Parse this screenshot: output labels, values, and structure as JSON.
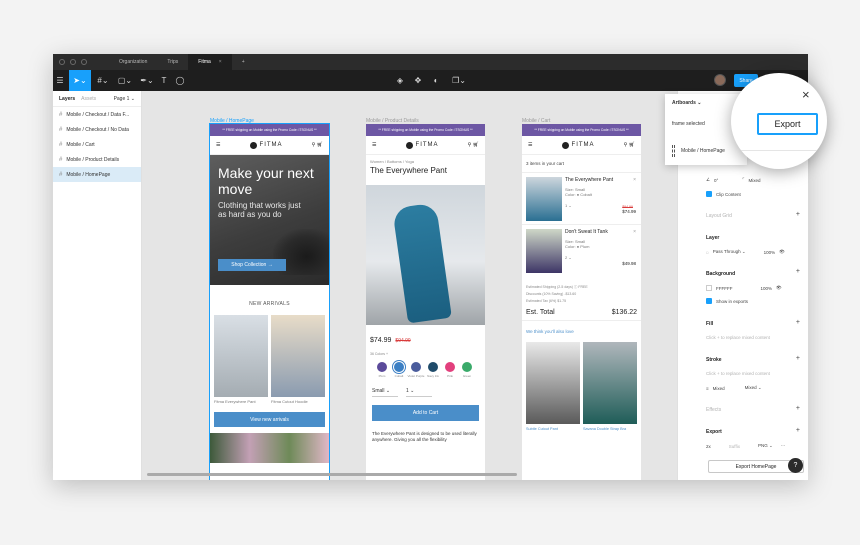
{
  "titlebar": {
    "tabs": [
      {
        "label": "Organization"
      },
      {
        "label": "Trips"
      },
      {
        "label": "Fitma",
        "active": true,
        "close": "×"
      },
      {
        "label": "+"
      }
    ]
  },
  "toolbar": {
    "share_label": "Share"
  },
  "layers": {
    "tab_layers": "Layers",
    "tab_assets": "Assets",
    "page": "Page 1 ⌄",
    "items": [
      {
        "label": "Mobile / Checkout / Data F..."
      },
      {
        "label": "Mobile / Checkout / No Data"
      },
      {
        "label": "Mobile / Cart"
      },
      {
        "label": "Mobile / Product Details"
      },
      {
        "label": "Mobile / HomePage",
        "selected": true
      }
    ]
  },
  "canvas": {
    "frame_labels": [
      "Mobile / HomePage",
      "Mobile / Product Details",
      "Mobile / Cart"
    ],
    "promo": "** FREE shipping on Mobile using the Promo Code: ITSONUS **",
    "logo": "FITMA",
    "home": {
      "headline": "Make your next move",
      "subhead": "Clothing that works just as hard as you do",
      "cta": "Shop Collection  →",
      "section": "NEW ARRIVALS",
      "captions": [
        "Fitma Everywhere Pant",
        "Fitma Cutout Hoodie"
      ],
      "view_btn": "View new arrivals"
    },
    "product": {
      "crumb": "Women / Bottoms / Yoga",
      "title": "The Everywhere Pant",
      "price": "$74.99",
      "old_price": "$94.99",
      "colors_label": "36 Colors +",
      "swatches": [
        {
          "name": "Plum",
          "color": "#5b4a9a"
        },
        {
          "name": "Cobalt",
          "color": "#3b7fc4"
        },
        {
          "name": "Violet Purple",
          "color": "#4a5c9c"
        },
        {
          "name": "Navy Ink",
          "color": "#1f4b6a"
        },
        {
          "name": "Pink",
          "color": "#e2407d"
        },
        {
          "name": "Green",
          "color": "#3aaa6a"
        }
      ],
      "size": "Small  ⌄",
      "qty": "1  ⌄",
      "add_cart": "Add to Cart",
      "desc": "The Everywhere Pant is designed to be used literally anywhere. Giving you all the flexibility"
    },
    "cart": {
      "count": "3 items in your cart",
      "items": [
        {
          "name": "The Everywhere Pant",
          "size": "Size:  Small",
          "color": "Color:  ● Cobalt",
          "qty": "1  ⌄",
          "old": "$94.99",
          "price": "$74.99"
        },
        {
          "name": "Don't Sweat It Tank",
          "size": "Size:  Small",
          "color": "Color:  ● Plum",
          "qty": "2  ⌄",
          "old": "",
          "price": "$49.98"
        }
      ],
      "summary": [
        "Estimated Shipping (2-5 days) ⓘ    FREE",
        "Discounts (10% Saving)    -$13.60",
        "Estimated Tax (6%)    $1.75"
      ],
      "total_label": "Est. Total",
      "total_value": "$136.22",
      "like": "We think you'll also love",
      "captions": [
        "Subtle Cutout Pant",
        "Savana Double Strap Bra"
      ]
    }
  },
  "props": {
    "clip": "Clip Content",
    "mixed": "Mixed",
    "angle": "0°",
    "layout_grid": "Layout Grid",
    "layer": "Layer",
    "pass": "Pass Through  ⌄",
    "pct": "100%",
    "background": "Background",
    "bg_hex": "FFFFFF",
    "bg_pct": "100%",
    "show_exports": "Show in exports",
    "fill": "Fill",
    "fill_hint": "Click + to replace mixed content",
    "stroke": "Stroke",
    "stroke_hint": "Click + to replace mixed content",
    "stroke_mixed": "Mixed",
    "stroke_mixed2": "Mixed  ⌄",
    "effects": "Effects",
    "export": "Export",
    "scale": "2x",
    "suffix": "Suffix",
    "format": "PNG  ⌄",
    "export_btn": "Export HomePage",
    "help": "?"
  },
  "popover": {
    "title": "Artboards ⌄",
    "frames_selected": "frame selected",
    "frame_name": "Mobile / HomePage"
  },
  "magnifier": {
    "export_label": "Export",
    "close": "×"
  }
}
